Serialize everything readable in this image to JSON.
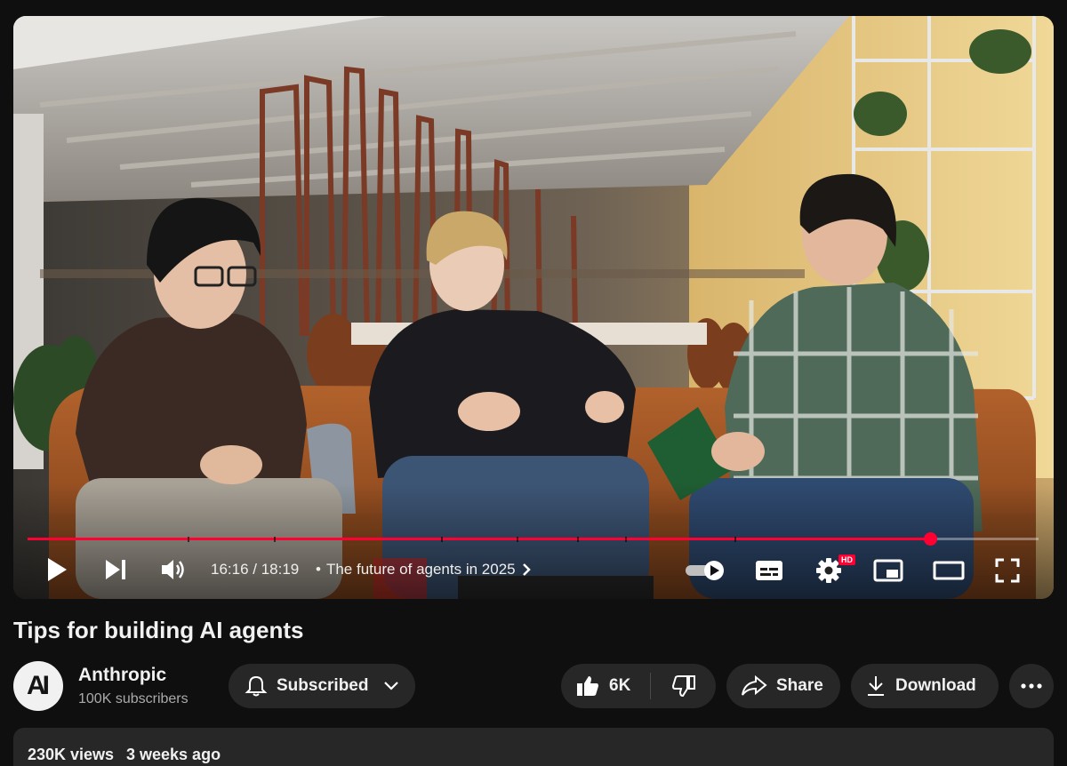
{
  "player": {
    "current_time": "16:16",
    "duration": "18:19",
    "time_display": "16:16 / 18:19",
    "chapter_title": "The future of agents in 2025",
    "progress_fraction": 0.8924,
    "quality_badge": "HD",
    "accent_color": "#ff0033",
    "icons": [
      "play-icon",
      "next-icon",
      "volume-icon",
      "autoplay-toggle-icon",
      "captions-icon",
      "settings-icon",
      "miniplayer-icon",
      "theater-icon",
      "fullscreen-icon"
    ]
  },
  "video": {
    "title": "Tips for building AI agents"
  },
  "channel": {
    "avatar_text": "AI",
    "name": "Anthropic",
    "subscribers": "100K subscribers"
  },
  "actions": {
    "subscribed_label": "Subscribed",
    "like_count": "6K",
    "share_label": "Share",
    "download_label": "Download"
  },
  "description": {
    "views": "230K views",
    "date": "3 weeks ago"
  }
}
